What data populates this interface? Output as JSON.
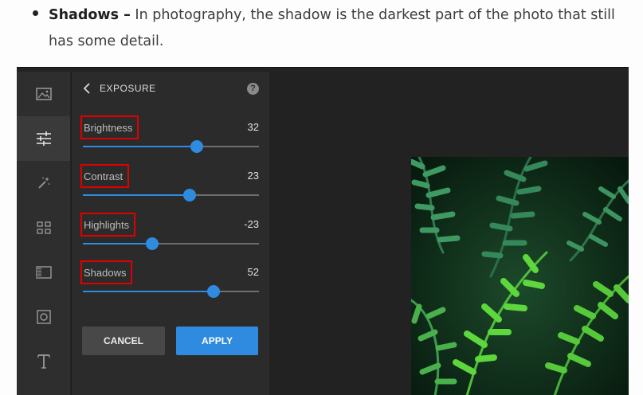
{
  "article": {
    "bullet_term": "Shadows –",
    "bullet_text": " In photography, the shadow is the darkest part of the photo that still has some detail."
  },
  "toolbar": {
    "tools": [
      {
        "name": "image-icon",
        "active": false
      },
      {
        "name": "adjust-sliders-icon",
        "active": true
      },
      {
        "name": "magic-wand-icon",
        "active": false
      },
      {
        "name": "grid-icon",
        "active": false
      },
      {
        "name": "texture-icon",
        "active": false
      },
      {
        "name": "frame-icon",
        "active": false
      },
      {
        "name": "text-icon",
        "active": false
      }
    ]
  },
  "panel": {
    "title": "EXPOSURE",
    "help_glyph": "?",
    "sliders": [
      {
        "label": "Brightness",
        "value": "32",
        "position": 0.645
      },
      {
        "label": "Contrast",
        "value": "23",
        "position": 0.605
      },
      {
        "label": "Highlights",
        "value": "-23",
        "position": 0.395
      },
      {
        "label": "Shadows",
        "value": "52",
        "position": 0.74
      }
    ],
    "cancel_label": "CANCEL",
    "apply_label": "APPLY"
  },
  "colors": {
    "accent": "#2e8be0",
    "highlight_box": "#e10000",
    "panel_bg": "#2b2b2b",
    "toolbar_bg": "#2e2e2e"
  }
}
